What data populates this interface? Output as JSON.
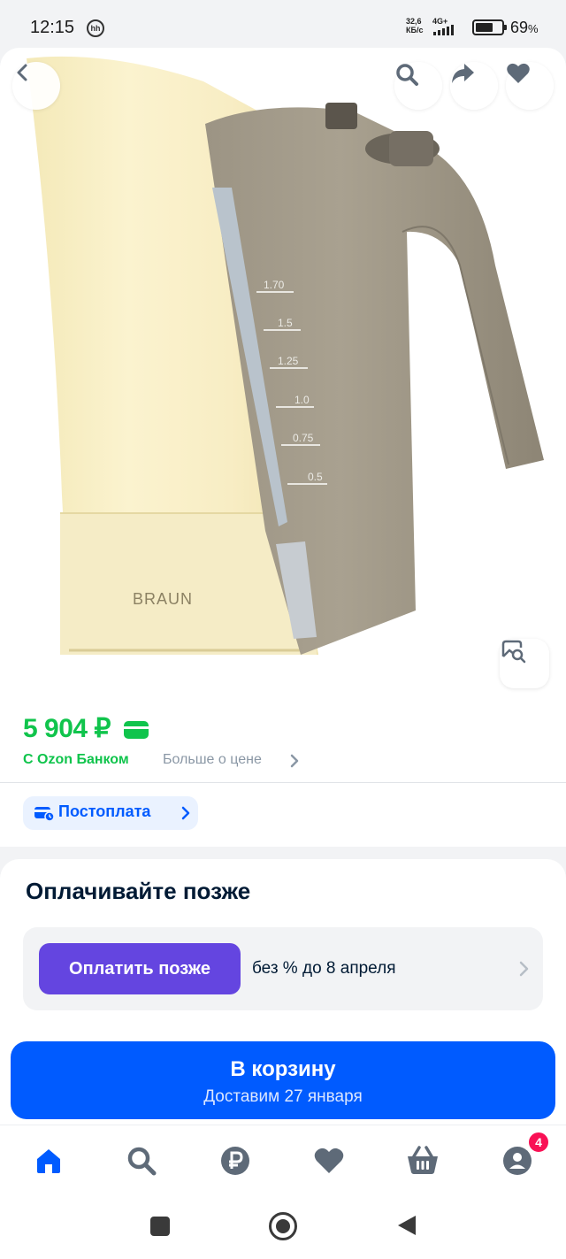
{
  "status_bar": {
    "time": "12:15",
    "hh_badge": "hh",
    "net_speed_value": "32,6",
    "net_speed_unit": "КБ/с",
    "network": "4G+",
    "battery_percent": "69",
    "battery_suffix": "%",
    "battery_level": 0.69
  },
  "gallery": {
    "brand_on_product": "BRAUN",
    "scale_marks": [
      "1.70",
      "1.5",
      "1.25",
      "1.0",
      "0.75",
      "0.5"
    ],
    "icons": {
      "back": "chevron-left-icon",
      "search": "search-icon",
      "share": "share-icon",
      "favorite": "heart-icon",
      "image_search": "image-search-icon"
    }
  },
  "price": {
    "amount": "5 904 ₽",
    "bank_label": "С Ozon Банком",
    "more_link": "Больше о цене"
  },
  "postpay": {
    "label": "Постоплата"
  },
  "bnpl": {
    "title": "Оплачивайте позже",
    "button": "Оплатить позже",
    "terms": "без % до 8 апреля"
  },
  "cart": {
    "label": "В корзину",
    "delivery": "Доставим 27 января"
  },
  "bottom_nav": {
    "items": [
      "home-icon",
      "search-icon",
      "ruble-icon",
      "heart-icon",
      "basket-icon",
      "profile-icon"
    ],
    "active": "home-icon",
    "profile_badge": "4"
  },
  "colors": {
    "accent": "#005bff",
    "price_green": "#10c44c",
    "bnpl_purple": "#6445e0",
    "badge_pink": "#f91155"
  }
}
